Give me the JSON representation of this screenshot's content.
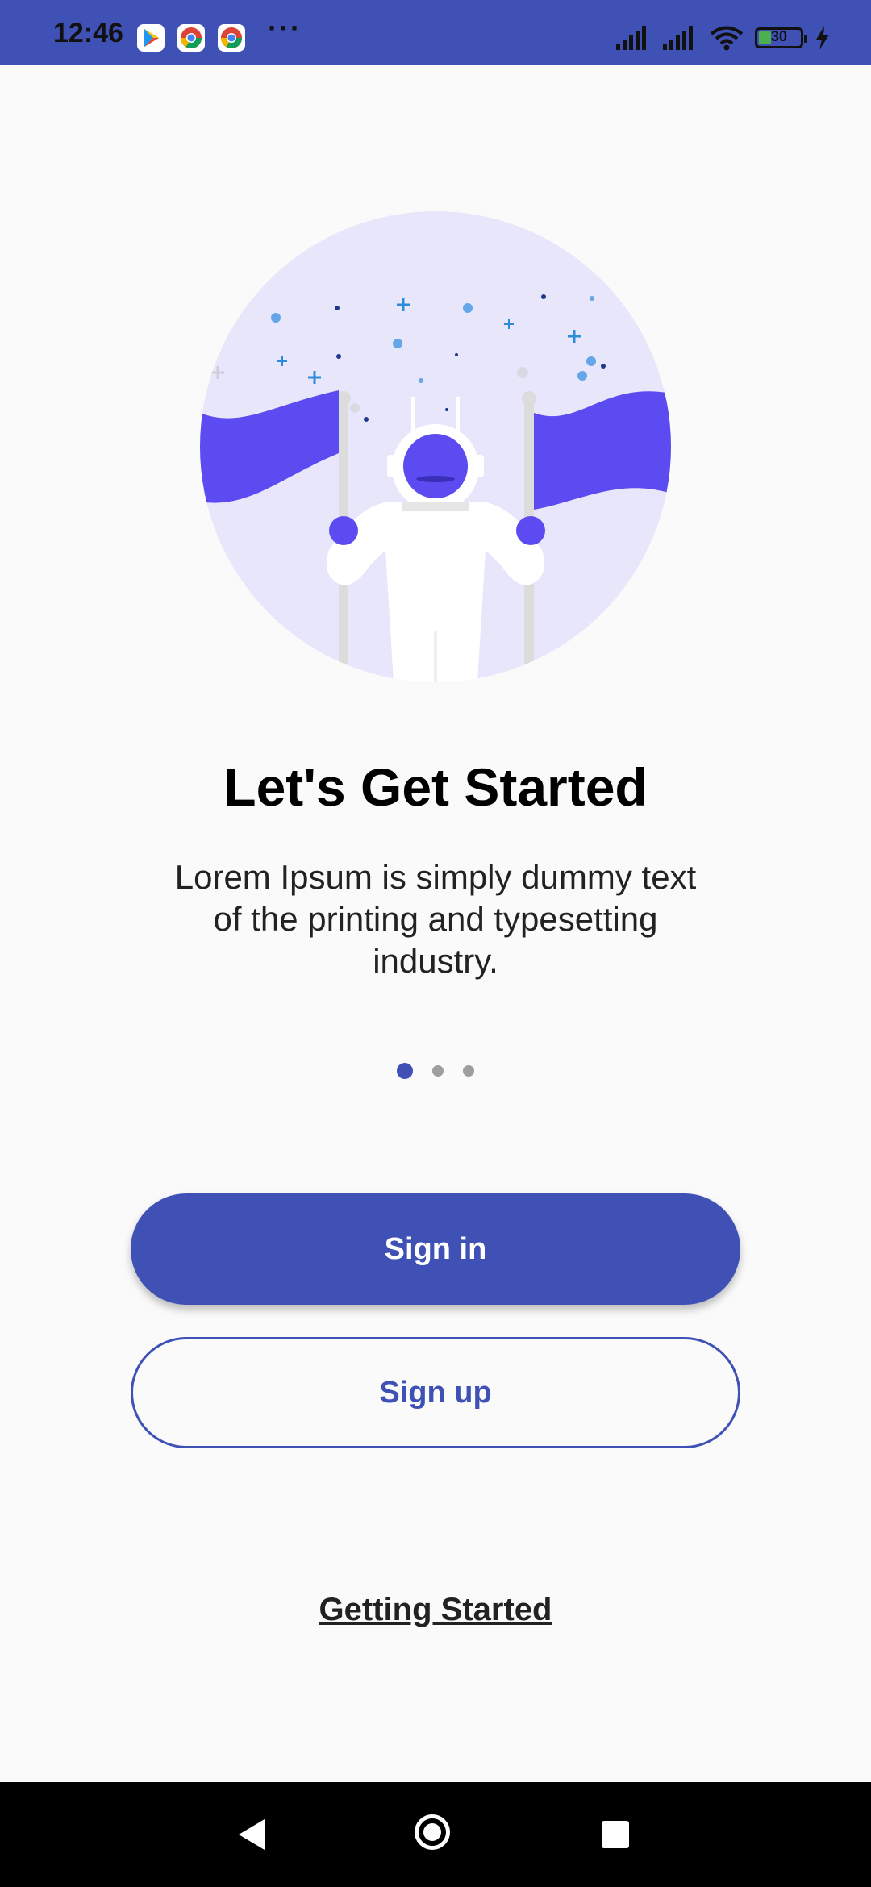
{
  "status_bar": {
    "time": "12:46",
    "more": "···",
    "battery_level": "30",
    "battery_fraction": 0.3
  },
  "onboarding": {
    "title": "Let's Get Started",
    "description": "Lorem Ipsum is simply dummy text of the printing and typesetting industry.",
    "page_count": 3,
    "active_page": 0
  },
  "buttons": {
    "sign_in": "Sign in",
    "sign_up": "Sign up"
  },
  "links": {
    "getting_started": "Getting Started"
  },
  "colors": {
    "primary": "#3F51B5",
    "accent": "#5B4BF0",
    "illustration_bg": "#E8E6FB"
  },
  "icons": {
    "play_store": "play-store-icon",
    "chrome": "chrome-icon",
    "signal": "signal-icon",
    "wifi": "wifi-icon",
    "battery": "battery-icon",
    "charging": "charging-bolt-icon",
    "back": "back-triangle-icon",
    "home": "home-circle-icon",
    "recents": "recents-square-icon"
  }
}
